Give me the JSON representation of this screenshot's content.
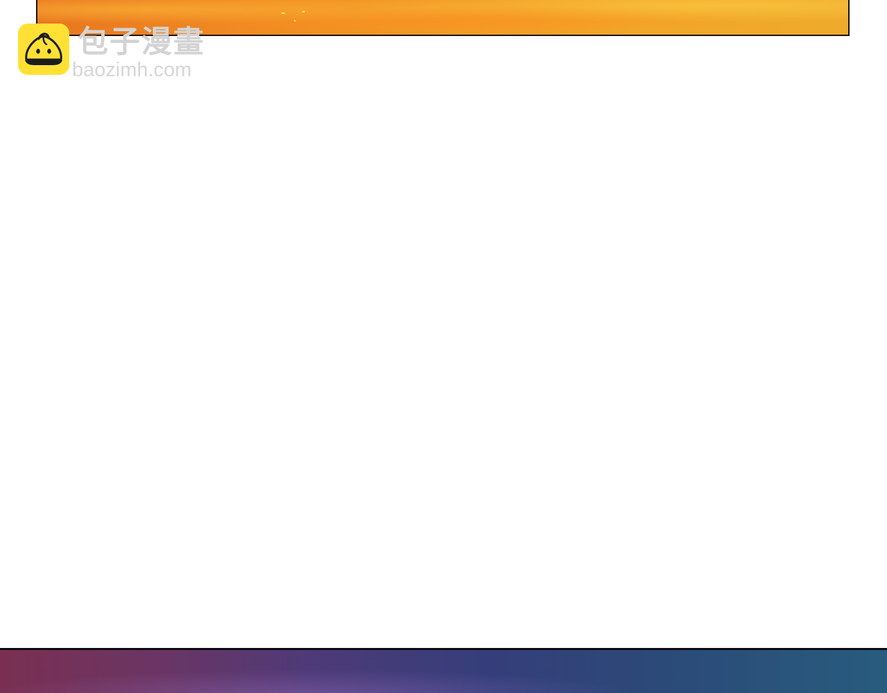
{
  "watermark": {
    "title": "包子漫畫",
    "url": "baozimh.com",
    "logo_icon": "bun-face-icon",
    "logo_color": "#ffe135",
    "text_color": "#d3d3d3"
  },
  "panels": {
    "top_color": "#f08a22",
    "bottom_color": "#4e3a78"
  }
}
